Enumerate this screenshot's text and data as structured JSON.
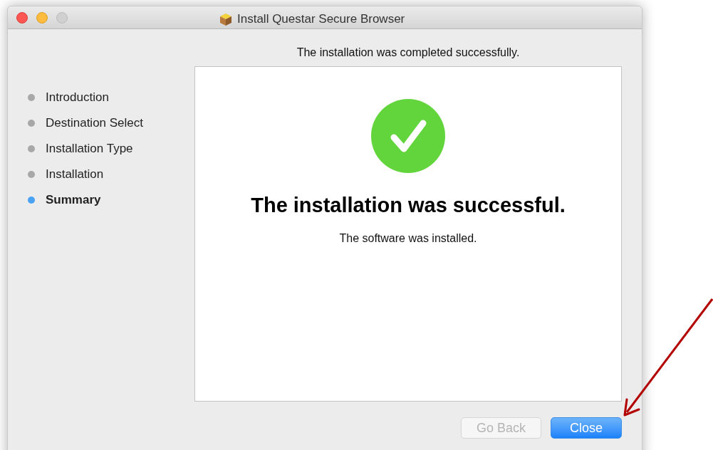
{
  "window": {
    "title": "Install Questar Secure Browser"
  },
  "sidebar": {
    "items": [
      {
        "label": "Introduction",
        "selected": false
      },
      {
        "label": "Destination Select",
        "selected": false
      },
      {
        "label": "Installation Type",
        "selected": false
      },
      {
        "label": "Installation",
        "selected": false
      },
      {
        "label": "Summary",
        "selected": true
      }
    ]
  },
  "status_text": "The installation was completed successfully.",
  "content": {
    "heading": "The installation was successful.",
    "message": "The software was installed."
  },
  "buttons": [
    {
      "label": "Go Back",
      "disabled": true,
      "default": false
    },
    {
      "label": "Close",
      "disabled": false,
      "default": true
    }
  ]
}
